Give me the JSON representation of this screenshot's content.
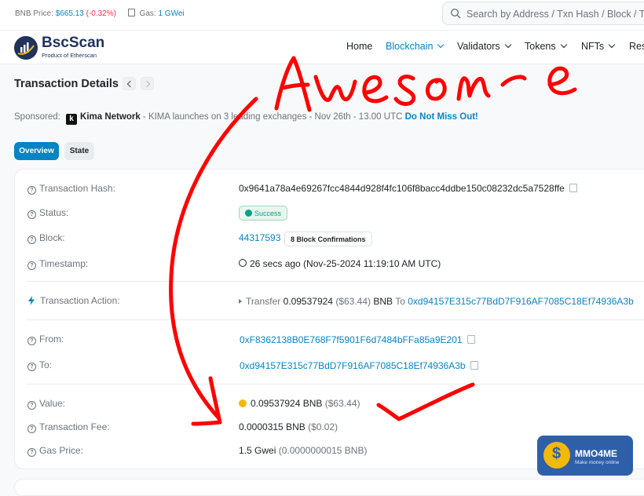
{
  "topbar": {
    "price_label": "BNB Price:",
    "price_value": "$665.13",
    "price_change": "(-0.32%)",
    "gas_label": "Gas:",
    "gas_value": "1 GWei",
    "search_placeholder": "Search by Address / Txn Hash / Block / Tok"
  },
  "brand": {
    "name": "BscScan",
    "tagline": "Product of Etherscan"
  },
  "nav": {
    "home": "Home",
    "blockchain": "Blockchain",
    "validators": "Validators",
    "tokens": "Tokens",
    "nfts": "NFTs",
    "resources": "Res"
  },
  "page": {
    "title": "Transaction Details"
  },
  "sponsor": {
    "label": "Sponsored:",
    "logo_letter": "k",
    "name": "Kima Network",
    "text": " - KIMA launches on 3 leading exchanges - Nov 26th - 13.00 UTC ",
    "cta": "Do Not Miss Out!"
  },
  "tabs": {
    "overview": "Overview",
    "state": "State"
  },
  "details": {
    "hash_label": "Transaction Hash:",
    "hash_value": "0x9641a78a4e69267fcc4844d928f4fc106f8bacc4ddbe150c08232dc5a7528ffe",
    "status_label": "Status:",
    "status_value": "Success",
    "block_label": "Block:",
    "block_value": "44317593",
    "block_confirmations": "8 Block Confirmations",
    "timestamp_label": "Timestamp:",
    "timestamp_value": "26 secs ago (Nov-25-2024 11:19:10 AM UTC)",
    "action_label": "Transaction Action:",
    "action_verb": "Transfer",
    "action_amount": "0.09537924",
    "action_usd": "($63.44)",
    "action_token": "BNB",
    "action_to": "To",
    "action_address": "0xd94157E315c77BdD7F916AF7085C18Ef74936A3b",
    "from_label": "From:",
    "from_value": "0xF8362138B0E768F7f5901F6d7484bFFa85a9E201",
    "to_label": "To:",
    "to_value": "0xd94157E315c77BdD7F916AF7085C18Ef74936A3b",
    "value_label": "Value:",
    "value_amount": "0.09537924 BNB",
    "value_usd": "($63.44)",
    "fee_label": "Transaction Fee:",
    "fee_amount": "0.0000315 BNB",
    "fee_usd": "($0.02)",
    "gas_price_label": "Gas Price:",
    "gas_price_value": "1.5 Gwei",
    "gas_price_detail": "(0.0000000015 BNB)"
  },
  "annotation": {
    "handwritten_text": "Awesome"
  },
  "watermark": {
    "title": "MMO4ME",
    "subtitle": "Make money online"
  },
  "colors": {
    "accent": "#0784c3",
    "brand": "#21325b",
    "success": "#00a186",
    "negative": "#dc3545",
    "annotation": "#ff0000"
  }
}
